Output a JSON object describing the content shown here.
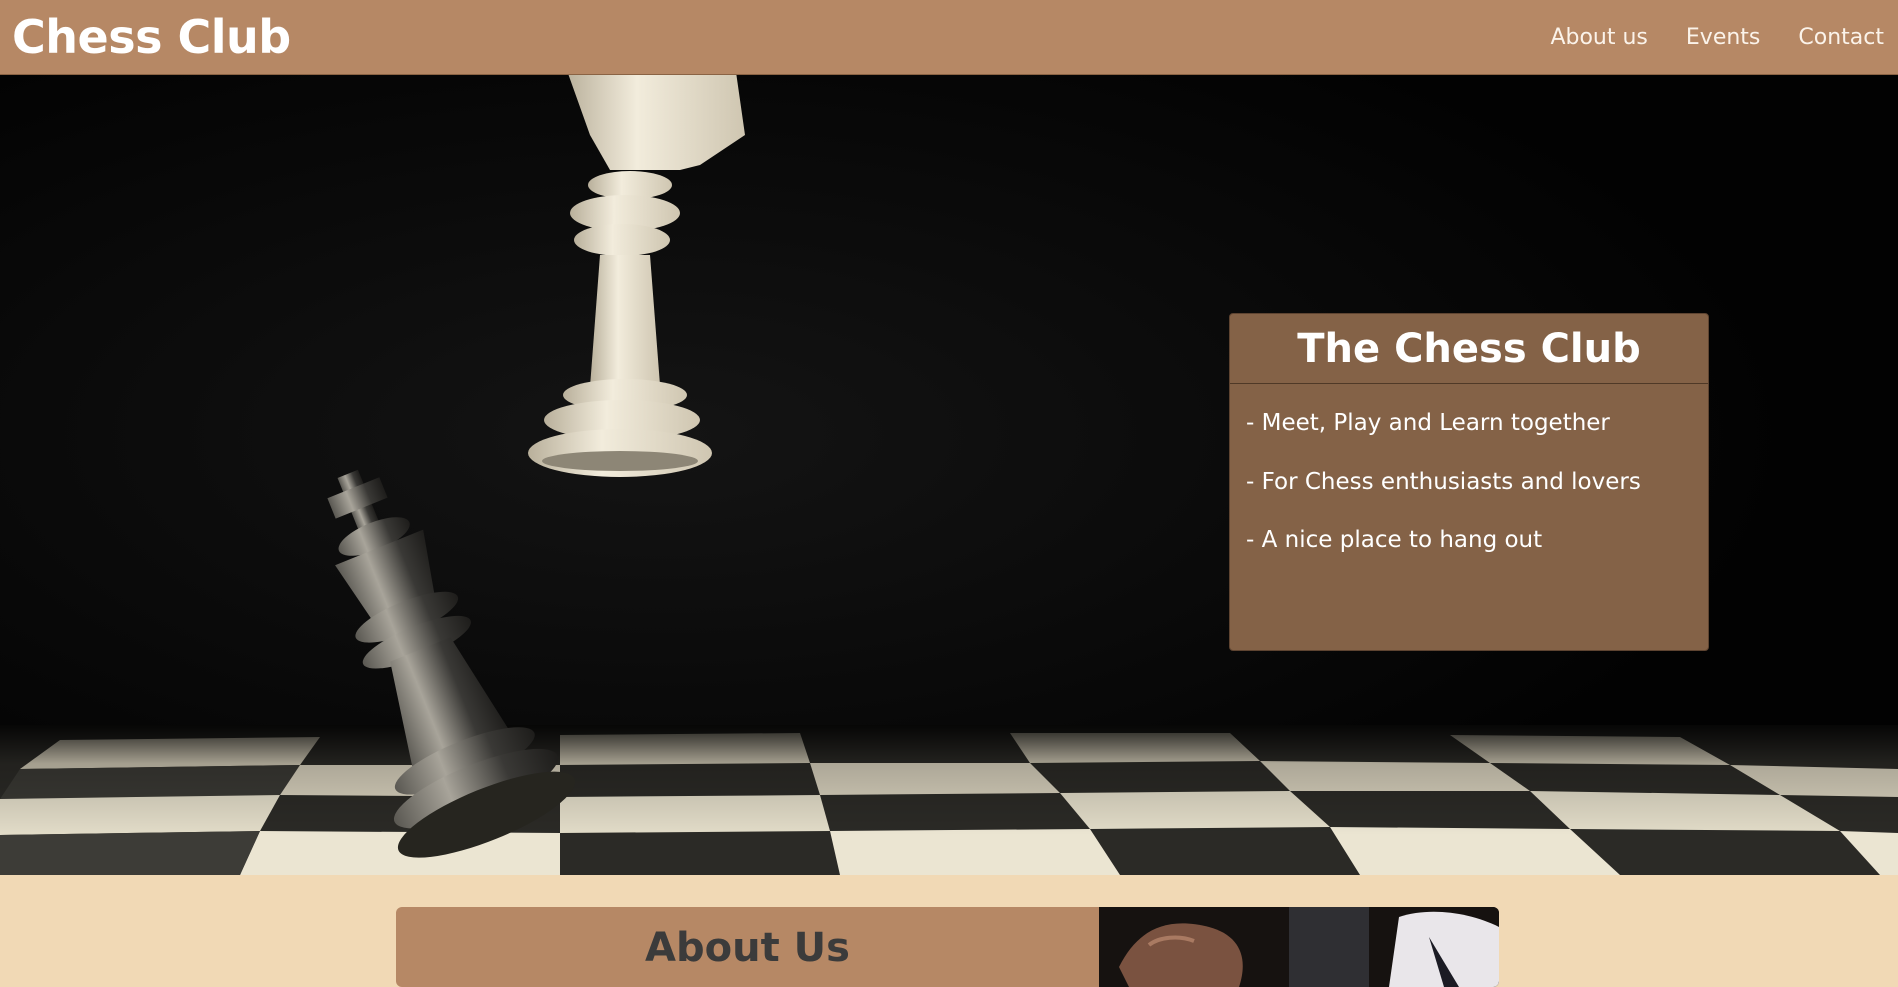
{
  "navbar": {
    "brand": "Chess Club",
    "links": [
      {
        "label": "About us"
      },
      {
        "label": "Events"
      },
      {
        "label": "Contact"
      }
    ],
    "background_color": "#b68865"
  },
  "hero": {
    "image_icon": "chess-kings-photo",
    "card": {
      "title": "The Chess Club",
      "items": [
        "- Meet, Play and Learn together",
        "- For Chess enthusiasts and lovers",
        "- A nice place to hang out"
      ],
      "background_color": "#846247"
    }
  },
  "about": {
    "title": "About Us",
    "image_icon": "chess-player-photo",
    "page_background_color": "#f1d9b5"
  }
}
